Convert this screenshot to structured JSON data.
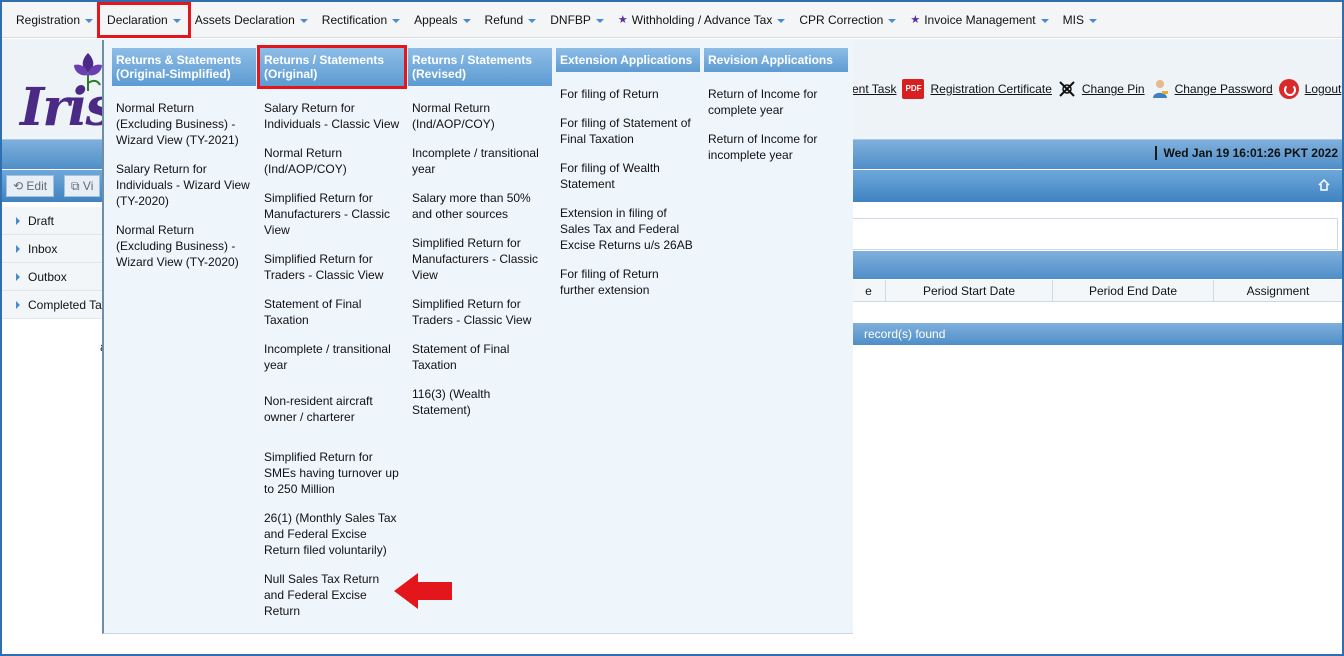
{
  "menubar": {
    "items": [
      {
        "label": "Registration",
        "star": false,
        "highlight": false
      },
      {
        "label": "Declaration",
        "star": false,
        "highlight": true
      },
      {
        "label": "Assets Declaration",
        "star": false,
        "highlight": false
      },
      {
        "label": "Rectification",
        "star": false,
        "highlight": false
      },
      {
        "label": "Appeals",
        "star": false,
        "highlight": false
      },
      {
        "label": "Refund",
        "star": false,
        "highlight": false
      },
      {
        "label": "DNFBP",
        "star": false,
        "highlight": false
      },
      {
        "label": "Withholding / Advance Tax",
        "star": true,
        "highlight": false
      },
      {
        "label": "CPR Correction",
        "star": false,
        "highlight": false
      },
      {
        "label": "Invoice Management",
        "star": true,
        "highlight": false
      },
      {
        "label": "MIS",
        "star": false,
        "highlight": false
      }
    ]
  },
  "header": {
    "logo_text": "Iris",
    "links": {
      "task": "ent Task",
      "registration_certificate": "Registration Certificate",
      "change_pin": "Change Pin",
      "change_password": "Change Password",
      "logout": "Logout"
    },
    "pdf_badge": "PDF",
    "datetime": "Wed Jan 19 16:01:26 PKT 2022"
  },
  "toolbar": {
    "edit": "Edit",
    "view": "Vi"
  },
  "sidebar": {
    "items": [
      "Draft",
      "Inbox",
      "Outbox",
      "Completed Ta"
    ]
  },
  "grid": {
    "columns": [
      "e",
      "Period Start Date",
      "Period End Date",
      "Assignment"
    ],
    "footer": "record(s) found",
    "side_letter": "a"
  },
  "dropdown": {
    "columns": [
      {
        "title": "Returns & Statements (Original-Simplified)",
        "highlight": false,
        "options": [
          "Normal Return (Excluding Business) - Wizard View (TY-2021)",
          "Salary Return for Individuals - Wizard View (TY-2020)",
          "Normal Return (Excluding Business) - Wizard View (TY-2020)"
        ]
      },
      {
        "title": "Returns / Statements (Original)",
        "highlight": true,
        "options": [
          "Salary Return for Individuals - Classic View",
          "Normal Return (Ind/AOP/COY)",
          "Simplified Return for Manufacturers - Classic View",
          "Simplified Return for Traders - Classic View",
          "Statement of Final Taxation",
          "Incomplete / transitional year",
          "Non-resident aircraft owner / charterer",
          "Simplified Return for SMEs having turnover up to 250 Million",
          "26(1) (Monthly Sales Tax and Federal Excise Return filed voluntarily)",
          "Null Sales Tax Return and Federal Excise Return"
        ]
      },
      {
        "title": "Returns / Statements (Revised)",
        "highlight": false,
        "options": [
          "Normal Return (Ind/AOP/COY)",
          "Incomplete / transitional year",
          "Salary more than 50% and other sources",
          "Simplified Return for Manufacturers - Classic View",
          "Simplified Return for Traders - Classic View",
          "Statement of Final Taxation",
          "116(3) (Wealth Statement)"
        ]
      },
      {
        "title": "Extension Applications",
        "highlight": false,
        "options": [
          "For filing of Return",
          "For filing of Statement of Final Taxation",
          "For filing of Wealth Statement",
          "Extension in filing of Sales Tax and Federal Excise Returns u/s 26AB",
          "For filing of Return further extension"
        ]
      },
      {
        "title": "Revision Applications",
        "highlight": false,
        "options": [
          "Return of Income for complete year",
          "Return of Income for incomplete year"
        ]
      }
    ]
  },
  "colors": {
    "highlight_red": "#e3161b",
    "header_blue": "#5d9bd2",
    "star_purple": "#5a2ea6"
  }
}
